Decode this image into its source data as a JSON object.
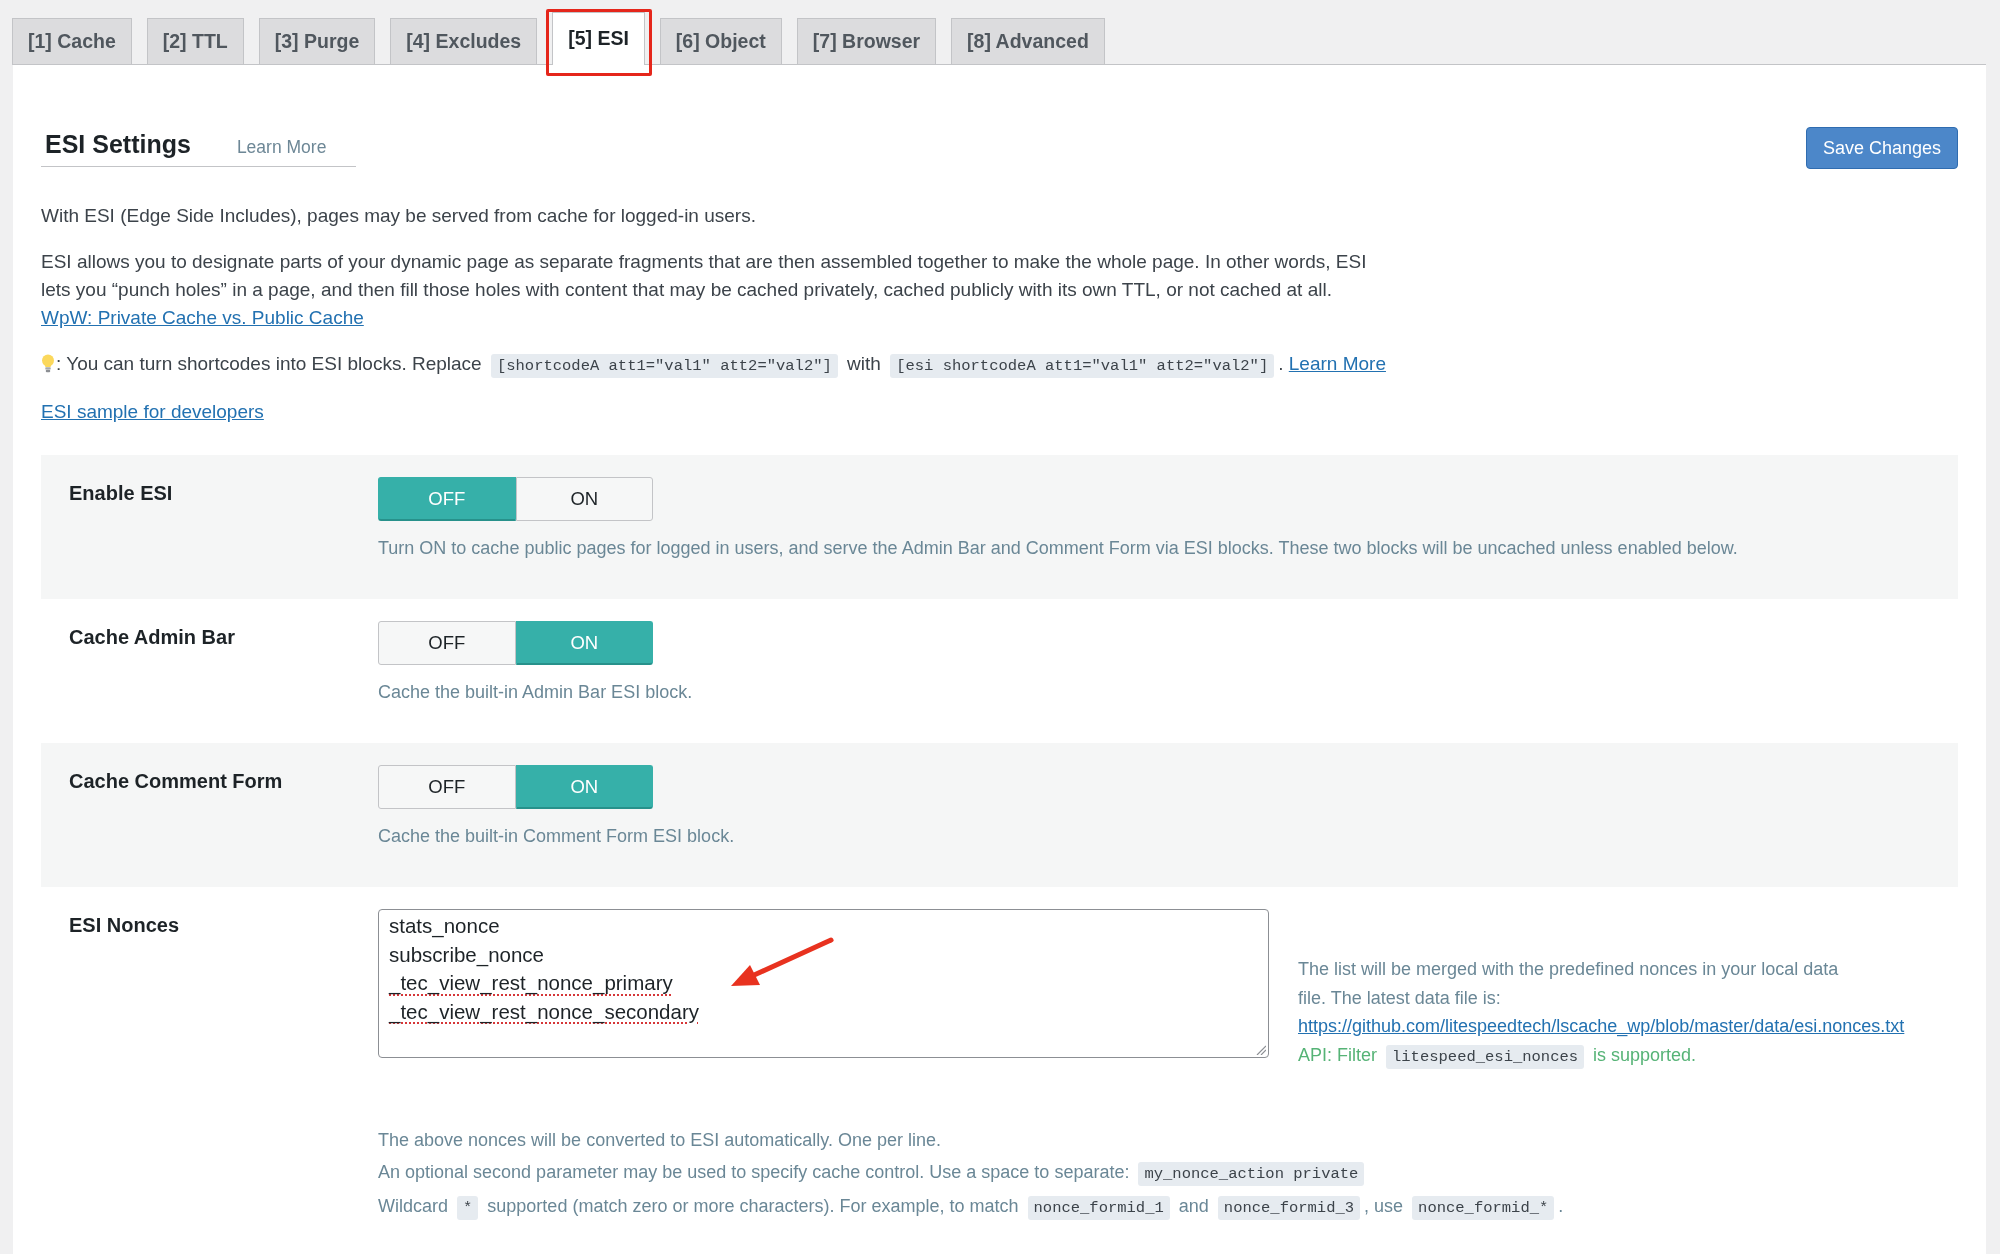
{
  "tabs": [
    {
      "label": "[1] Cache",
      "selected": false,
      "highlighted": false
    },
    {
      "label": "[2] TTL",
      "selected": false,
      "highlighted": false
    },
    {
      "label": "[3] Purge",
      "selected": false,
      "highlighted": false
    },
    {
      "label": "[4] Excludes",
      "selected": false,
      "highlighted": false
    },
    {
      "label": "[5] ESI",
      "selected": true,
      "highlighted": true
    },
    {
      "label": "[6] Object",
      "selected": false,
      "highlighted": false
    },
    {
      "label": "[7] Browser",
      "selected": false,
      "highlighted": false
    },
    {
      "label": "[8] Advanced",
      "selected": false,
      "highlighted": false
    }
  ],
  "header": {
    "title": "ESI Settings",
    "learn_more": "Learn More",
    "save_button": "Save Changes"
  },
  "intro": {
    "summary": "With ESI (Edge Side Includes), pages may be served from cache for logged-in users.",
    "explanation": {
      "text": "ESI allows you to designate parts of your dynamic page as separate fragments that are then assembled together to make the whole page. In other words, ESI lets you “punch holes” in a page, and then fill those holes with content that may be cached privately, cached publicly with its own TTL, or not cached at all.",
      "link": "WpW: Private Cache vs. Public Cache"
    },
    "tip": [
      {
        "kind": "text",
        "text": ": You can turn shortcodes into ESI blocks. Replace "
      },
      {
        "kind": "code",
        "text": "[shortcodeA att1=\"val1\" att2=\"val2\"]"
      },
      {
        "kind": "text",
        "text": " with "
      },
      {
        "kind": "code",
        "text": "[esi shortcodeA att1=\"val1\" att2=\"val2\"]"
      },
      {
        "kind": "text",
        "text": ". "
      },
      {
        "kind": "link",
        "text": "Learn More"
      }
    ],
    "developer_link": "ESI sample for developers"
  },
  "settings": [
    {
      "kind": "toggle",
      "label": "Enable ESI",
      "options": [
        {
          "label": "OFF",
          "selected": true
        },
        {
          "label": "ON",
          "selected": false
        }
      ],
      "description": "Turn ON to cache public pages for logged in users, and serve the Admin Bar and Comment Form via ESI blocks. These two blocks will be uncached unless enabled below."
    },
    {
      "kind": "toggle",
      "label": "Cache Admin Bar",
      "options": [
        {
          "label": "OFF",
          "selected": false
        },
        {
          "label": "ON",
          "selected": true
        }
      ],
      "description": "Cache the built-in Admin Bar ESI block."
    },
    {
      "kind": "toggle",
      "label": "Cache Comment Form",
      "options": [
        {
          "label": "OFF",
          "selected": false
        },
        {
          "label": "ON",
          "selected": true
        }
      ],
      "description": "Cache the built-in Comment Form ESI block."
    },
    {
      "kind": "textarea",
      "label": "ESI Nonces",
      "lines": [
        {
          "text": "stats_nonce",
          "misspelled": false
        },
        {
          "text": "subscribe_nonce",
          "misspelled": false
        },
        {
          "text": "_tec_view_rest_nonce_primary",
          "misspelled": true
        },
        {
          "text": "_tec_view_rest_nonce_secondary",
          "misspelled": true
        }
      ],
      "annotation_arrow": true,
      "side_note": {
        "text": "The list will be merged with the predefined nonces in your local data file. The latest data file is:",
        "link": "https://github.com/litespeedtech/lscache_wp/blob/master/data/esi.nonces.txt",
        "api": [
          {
            "kind": "text",
            "text": "API: Filter "
          },
          {
            "kind": "code",
            "text": "litespeed_esi_nonces"
          },
          {
            "kind": "text",
            "text": " is supported."
          }
        ]
      },
      "notes": [
        [
          {
            "kind": "text",
            "text": "The above nonces will be converted to ESI automatically. One per line."
          }
        ],
        [
          {
            "kind": "text",
            "text": "An optional second parameter may be used to specify cache control. Use a space to separate: "
          },
          {
            "kind": "code",
            "text": "my_nonce_action private"
          }
        ],
        [
          {
            "kind": "text",
            "text": "Wildcard "
          },
          {
            "kind": "code",
            "text": "*"
          },
          {
            "kind": "text",
            "text": " supported (match zero or more characters). For example, to match "
          },
          {
            "kind": "code",
            "text": "nonce_formid_1"
          },
          {
            "kind": "text",
            "text": " and "
          },
          {
            "kind": "code",
            "text": "nonce_formid_3"
          },
          {
            "kind": "text",
            "text": ", use "
          },
          {
            "kind": "code",
            "text": "nonce_formid_*"
          },
          {
            "kind": "text",
            "text": "."
          }
        ]
      ]
    }
  ]
}
